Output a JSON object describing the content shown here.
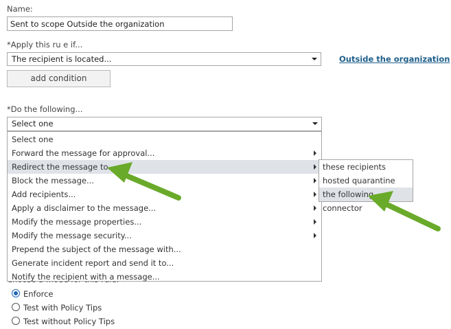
{
  "name_section": {
    "label": "Name:",
    "value": "Sent to scope Outside the organization"
  },
  "apply_section": {
    "label": "*Apply this ru e if...",
    "condition_value": "The recipient is located...",
    "condition_link": "Outside the organization",
    "add_condition_label": "add condition"
  },
  "do_section": {
    "label": "*Do the following...",
    "select_value": "Select one",
    "menu_items": [
      {
        "label": "Select one",
        "submenu": false
      },
      {
        "label": "Forward the message for approval...",
        "submenu": true
      },
      {
        "label": "Redirect the message to...",
        "submenu": true,
        "highlighted": true
      },
      {
        "label": "Block the message...",
        "submenu": true
      },
      {
        "label": "Add recipients...",
        "submenu": true
      },
      {
        "label": "Apply a disclaimer to the message...",
        "submenu": true
      },
      {
        "label": "Modify the message properties...",
        "submenu": true
      },
      {
        "label": "Modify the message security...",
        "submenu": true
      },
      {
        "label": "Prepend the subject of the message with...",
        "submenu": false
      },
      {
        "label": "Generate incident report and send it to...",
        "submenu": false
      },
      {
        "label": "Notify the recipient with a message...",
        "submenu": false
      }
    ],
    "submenu_items": [
      {
        "label": "these recipients"
      },
      {
        "label": "hosted quarantine"
      },
      {
        "label": "the following connector",
        "highlighted": true
      }
    ]
  },
  "mode_section": {
    "label": "Choose a mode for this rule:",
    "options": [
      {
        "label": "Enforce",
        "selected": true
      },
      {
        "label": "Test with Policy Tips",
        "selected": false
      },
      {
        "label": "Test without Policy Tips",
        "selected": false
      }
    ]
  },
  "colors": {
    "arrow": "#6aaa2a",
    "link": "#1f5f8b",
    "highlight": "#dfe3e8",
    "radio_selected": "#1d66b3"
  }
}
